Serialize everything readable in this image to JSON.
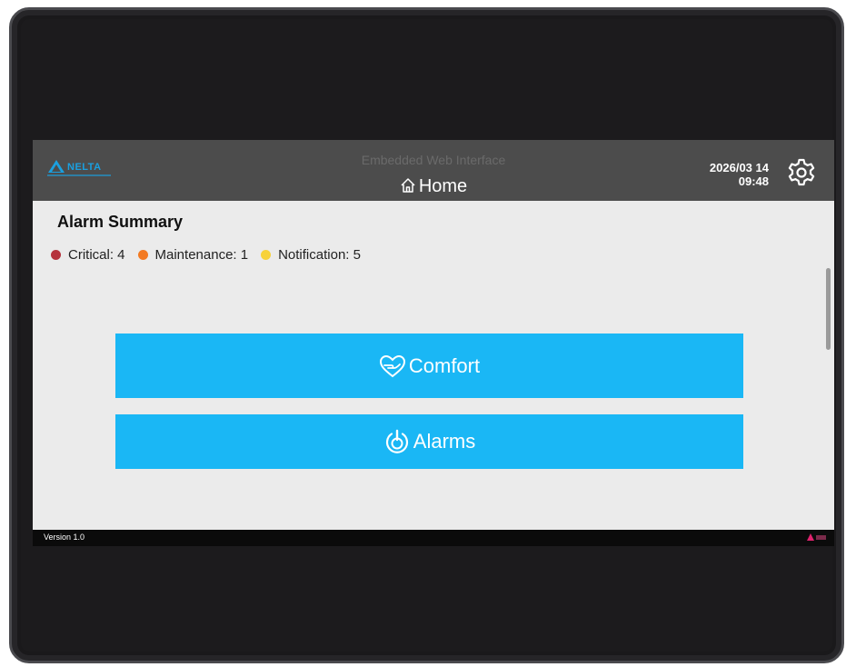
{
  "header": {
    "logo_text": "NELTA",
    "subtitle": "Embedded Web Interface",
    "title": "Home",
    "date": "2026/03 14",
    "time": "09:48",
    "settings_icon": "gear-icon"
  },
  "alarm_summary": {
    "title": "Alarm Summary",
    "items": [
      {
        "label": "Critical: 4",
        "color": "#b5323c"
      },
      {
        "label": "Maintenance: 1",
        "color": "#f37a22"
      },
      {
        "label": "Notification: 5",
        "color": "#f7d23a"
      }
    ]
  },
  "buttons": {
    "comfort": {
      "label": "Comfort",
      "icon": "heart-hand-icon"
    },
    "alarms": {
      "label": "Alarms",
      "icon": "power-alarm-icon"
    }
  },
  "footer": {
    "version": "Version 1.0"
  },
  "colors": {
    "accent": "#1ab7f5",
    "header_bg": "#4c4c4c",
    "brand": "#1aa0e0"
  }
}
